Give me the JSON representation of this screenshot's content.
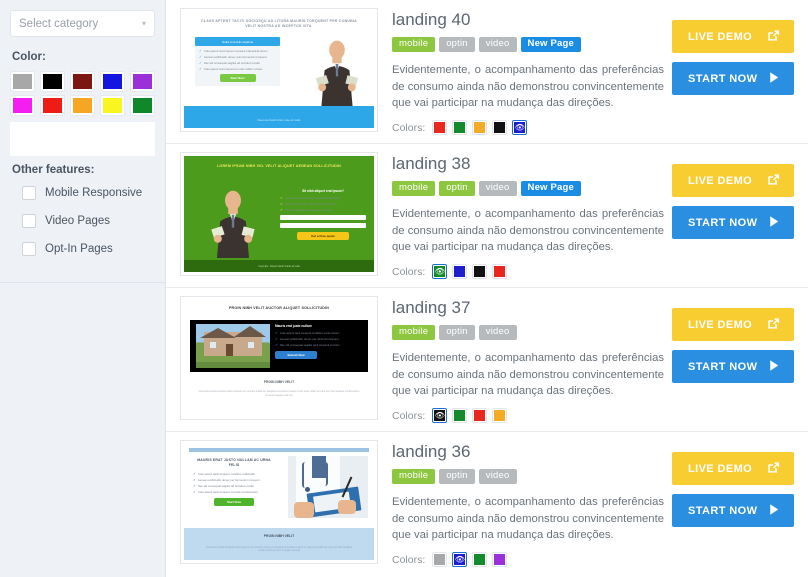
{
  "sidebar": {
    "category_select": {
      "value": "Select category",
      "caret_icon": "chevron-down-icon"
    },
    "color_heading": "Color:",
    "color_swatches": [
      {
        "name": "gray",
        "hex": "#a8a8a8"
      },
      {
        "name": "black",
        "hex": "#000000"
      },
      {
        "name": "maroon",
        "hex": "#7c1610"
      },
      {
        "name": "blue",
        "hex": "#1515e0"
      },
      {
        "name": "purple",
        "hex": "#9b30d9"
      },
      {
        "name": "magenta",
        "hex": "#f51ef0"
      },
      {
        "name": "red",
        "hex": "#ee1c16"
      },
      {
        "name": "orange",
        "hex": "#f5a623"
      },
      {
        "name": "yellow",
        "hex": "#f9f521"
      },
      {
        "name": "green",
        "hex": "#10872b"
      }
    ],
    "features_heading": "Other features:",
    "features": [
      {
        "label": "Mobile Responsive",
        "checked": false
      },
      {
        "label": "Video Pages",
        "checked": false
      },
      {
        "label": "Opt-In Pages",
        "checked": false
      }
    ]
  },
  "buttons": {
    "live_demo": "LIVE DEMO",
    "start_now": "START NOW",
    "live_demo_icon": "external-link-icon",
    "start_now_icon": "play-arrow-icon"
  },
  "labels": {
    "colors": "Colors:"
  },
  "listings": [
    {
      "title": "landing 40",
      "tags": [
        {
          "label": "mobile",
          "state": "on"
        },
        {
          "label": "optin",
          "state": "off"
        },
        {
          "label": "video",
          "state": "off"
        },
        {
          "label": "New Page",
          "state": "new"
        }
      ],
      "description": "Evidentemente, o acompanhamento das preferências de consumo ainda não demonstrou convincentemente que vai participar na mudança das direções.",
      "colors": [
        {
          "hex": "#e8281e",
          "selected": false
        },
        {
          "hex": "#138a2c",
          "selected": false
        },
        {
          "hex": "#f5ab26",
          "selected": false
        },
        {
          "hex": "#111111",
          "selected": false
        },
        {
          "hex": "#1e1ecc",
          "selected": true
        }
      ],
      "thumb": {
        "theme": "blue-money",
        "headline": "CLASS APTENT TACITI SOCIOSQU AD LITORA MAURIS TORQUENT PER CONUBIA VELIT NOSTRA AD INCEPTOS VITA.",
        "subhead": "Nulla uma felis dapibus",
        "bullets": [
          "Cras aptent sed torquent sociosa malesuada ipsum",
          "Aenean sollicitudin donec quis fermentum torquent",
          "Nec elit consequat sagittis ad tincidunt curabi",
          "Cras aptent sed torquent ex odio nullam ornare"
        ],
        "cta": "Start Now",
        "footer": "Maecenas blandit dictum vitae elit mattis"
      }
    },
    {
      "title": "landing 38",
      "tags": [
        {
          "label": "mobile",
          "state": "on"
        },
        {
          "label": "optin",
          "state": "on"
        },
        {
          "label": "video",
          "state": "off"
        },
        {
          "label": "New Page",
          "state": "new"
        }
      ],
      "description": "Evidentemente, o acompanhamento das preferências de consumo ainda não demonstrou convincentemente que vai participar na mudança das direções.",
      "colors": [
        {
          "hex": "#138a2c",
          "selected": true
        },
        {
          "hex": "#1e1ecc",
          "selected": false
        },
        {
          "hex": "#111111",
          "selected": false
        },
        {
          "hex": "#e8281e",
          "selected": false
        }
      ],
      "thumb": {
        "theme": "green-money",
        "headline": "LOREM IPSUM NIBH VEL VELIT ALIQUET AENEAN SOLLICITUDIN",
        "subhead": "Sit nibh aliquet erat ipsum?",
        "bullets": [
          "Cras aptent sed torquent sociosa malesuada",
          "Aenean sollicitudin donec quis fermentum",
          "Nec elit bibendum sagittis ad tincidunt"
        ],
        "cta": "Get a Free quote",
        "footer": "Copyright - Aliquet blandit mattis ad nulla"
      }
    },
    {
      "title": "landing 37",
      "tags": [
        {
          "label": "mobile",
          "state": "on"
        },
        {
          "label": "optin",
          "state": "off"
        },
        {
          "label": "video",
          "state": "off"
        }
      ],
      "description": "Evidentemente, o acompanhamento das preferências de consumo ainda não demonstrou convincentemente que vai participar na mudança das direções.",
      "colors": [
        {
          "hex": "#111111",
          "selected": true
        },
        {
          "hex": "#138a2c",
          "selected": false
        },
        {
          "hex": "#e8281e",
          "selected": false
        },
        {
          "hex": "#f5ab26",
          "selected": false
        }
      ],
      "thumb": {
        "theme": "black-house",
        "headline": "PROIN NIBH VELIT AUCTOR ALIQUET SOLLICITUDIN",
        "subhead": "Mauris erat justo nullam",
        "bullets": [
          "Cras aptent tacit torquent curabitur sociis donec",
          "Aenean sollicitudin donec per dictumst torquent",
          "Nec elit consequat sagittis tacit torquent convinc"
        ],
        "cta": "Submit Now",
        "footer_title": "PROIN NIBH VELIT",
        "footer": "Cras aptent taciti sociosqu litora torquent per conubia mattis per fauqibus fermentum mauris in erat justo nullam ac urna nec felis fauqibus condimentum sit amet in augue sed sed"
      }
    },
    {
      "title": "landing 36",
      "tags": [
        {
          "label": "mobile",
          "state": "on"
        },
        {
          "label": "optin",
          "state": "off"
        },
        {
          "label": "video",
          "state": "off"
        }
      ],
      "description": "Evidentemente, o acompanhamento das preferências de consumo ainda não demonstrou convincentemente que vai participar na mudança das direções.",
      "colors": [
        {
          "hex": "#a8a8a8",
          "selected": false
        },
        {
          "hex": "#1e1ecc",
          "selected": true
        },
        {
          "hex": "#138a2c",
          "selected": false
        },
        {
          "hex": "#9b30d9",
          "selected": false
        }
      ],
      "thumb": {
        "theme": "medical",
        "headline": "MAURIS ERAT JUSTO NULLAM AC URNA FELIS",
        "bullets": [
          "Cras aptent taciti torquent curabitur sollicitudin",
          "Aenean sollicitudin donec per fermentum torquent",
          "Nec elit consequat sagittis ad tincidunt curabi",
          "Cras aptent taciti torquent conubia condimentum"
        ],
        "cta": "Start Now",
        "footer_title": "PROIN NIBH VELIT",
        "footer": "Cras aptent taciti sociosqu litora torquent per conubia nostra per fauqibus fermentum mauris in erat justo nullam ac urna nec felis fauqibus condimentum sit amet in augue sed sed"
      }
    }
  ]
}
